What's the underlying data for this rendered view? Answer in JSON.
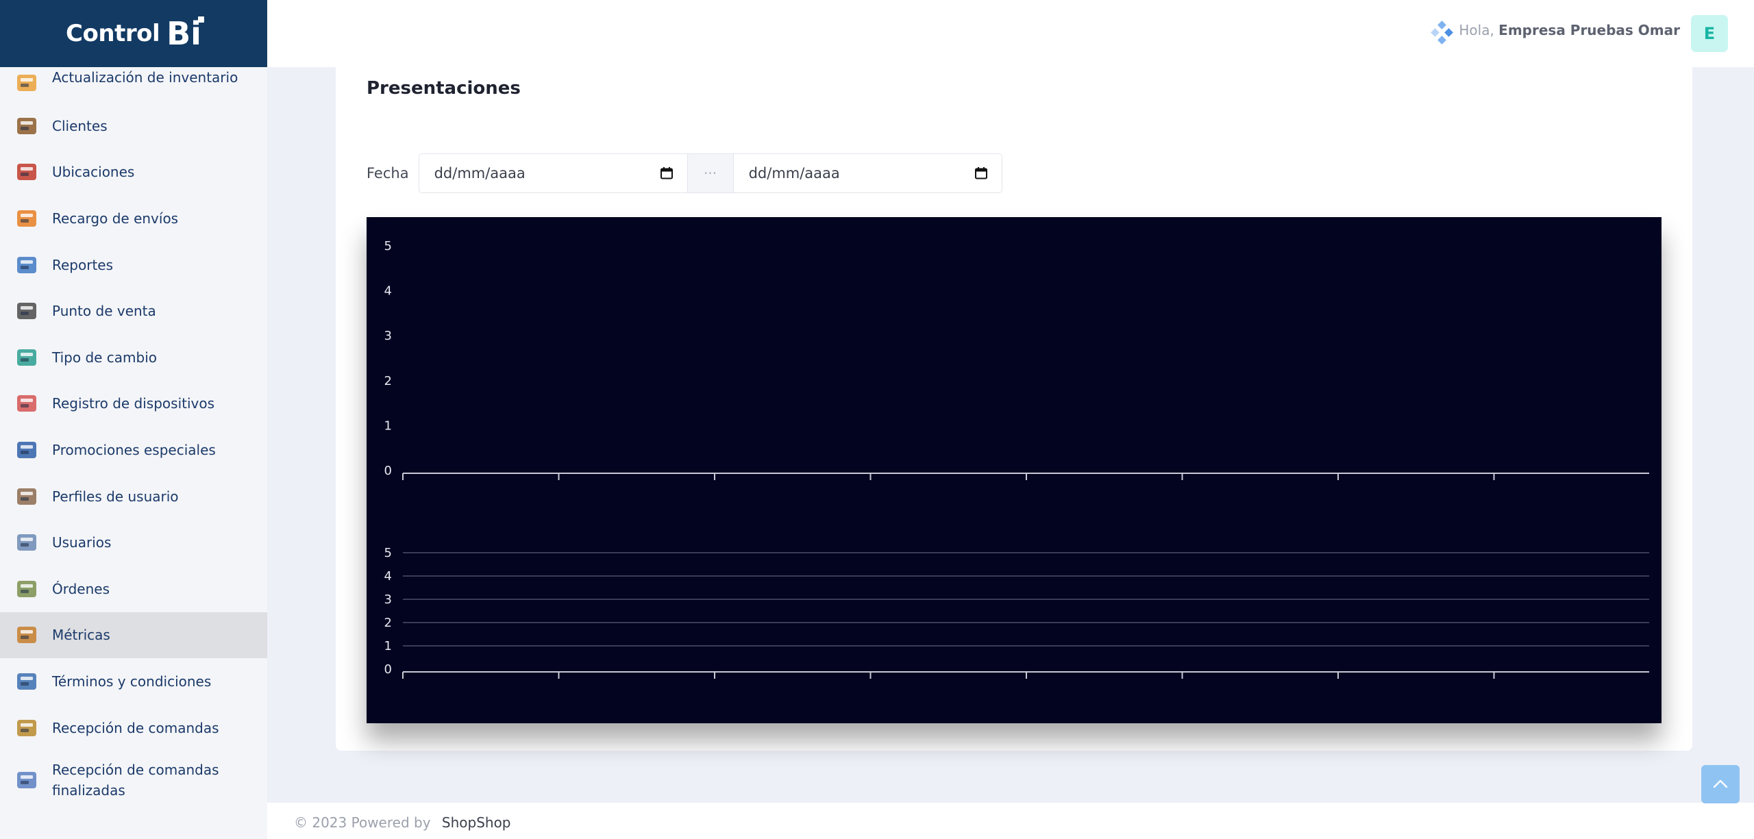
{
  "brand": {
    "name": "Control",
    "mark": "Bi"
  },
  "header": {
    "greeting_prefix": "Hola,",
    "user_name": "Empresa Pruebas Omar",
    "avatar_letter": "E"
  },
  "sidebar": {
    "items": [
      {
        "label": "Actualización de inventario",
        "icon": "inventory-icon"
      },
      {
        "label": "Clientes",
        "icon": "clients-icon"
      },
      {
        "label": "Ubicaciones",
        "icon": "location-pin-icon"
      },
      {
        "label": "Recargo de envíos",
        "icon": "delivery-scooter-icon"
      },
      {
        "label": "Reportes",
        "icon": "reports-icon"
      },
      {
        "label": "Punto de venta",
        "icon": "pos-terminal-icon"
      },
      {
        "label": "Tipo de cambio",
        "icon": "exchange-phone-icon"
      },
      {
        "label": "Registro de dispositivos",
        "icon": "devices-icon"
      },
      {
        "label": "Promociones especiales",
        "icon": "promotions-icon"
      },
      {
        "label": "Perfiles de usuario",
        "icon": "user-profile-icon"
      },
      {
        "label": "Usuarios",
        "icon": "users-icon"
      },
      {
        "label": "Órdenes",
        "icon": "orders-icon"
      },
      {
        "label": "Métricas",
        "icon": "metrics-icon",
        "active": true
      },
      {
        "label": "Términos y condiciones",
        "icon": "terms-icon"
      },
      {
        "label": "Recepción de comandas",
        "icon": "clipboard-icon"
      },
      {
        "label": "Recepción de comandas finalizadas",
        "icon": "finished-orders-icon"
      }
    ]
  },
  "main": {
    "title": "Presentaciones",
    "filter": {
      "label": "Fecha",
      "start_placeholder": "dd/mm/aaaa",
      "separator": "···",
      "end_placeholder": "dd/mm/aaaa"
    }
  },
  "chart_data": [
    {
      "type": "bar",
      "categories": [
        "",
        "",
        "",
        "",
        "",
        "",
        "",
        ""
      ],
      "values": [],
      "title": "",
      "xlabel": "",
      "ylabel": "",
      "ylim": [
        0,
        5
      ],
      "yticks": [
        "0",
        "1",
        "2",
        "3",
        "4",
        "5"
      ],
      "grid": false
    },
    {
      "type": "bar",
      "categories": [
        "",
        "",
        "",
        "",
        "",
        "",
        "",
        ""
      ],
      "values": [],
      "title": "",
      "xlabel": "",
      "ylabel": "",
      "ylim": [
        0,
        5
      ],
      "yticks": [
        "0",
        "1",
        "2",
        "3",
        "4",
        "5"
      ],
      "grid": true
    }
  ],
  "colors": {
    "brand": "#123a63",
    "chart_bg": "#020420",
    "accent": "#19b4a4",
    "scroll_button": "#8fc4f2"
  },
  "footer": {
    "copyright": "© 2023 Powered by",
    "brand": "ShopShop"
  }
}
